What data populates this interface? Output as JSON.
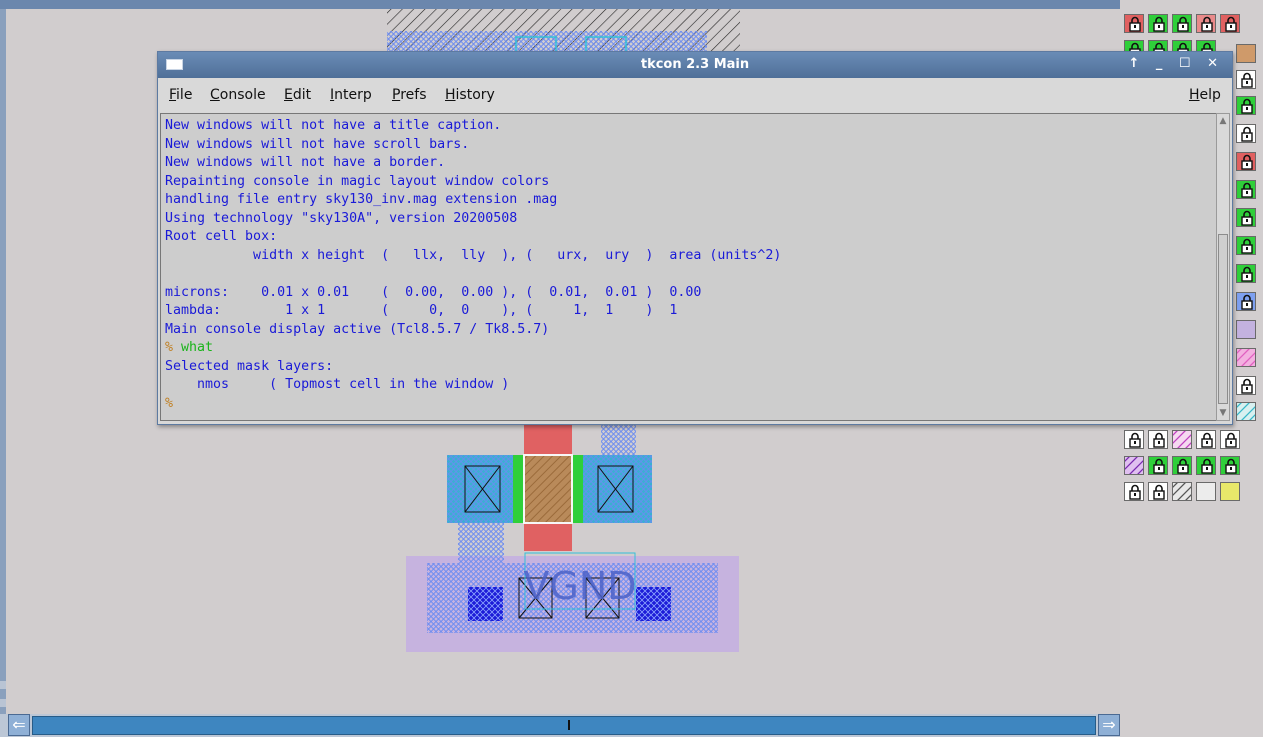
{
  "tkcon": {
    "title": "tkcon 2.3 Main",
    "window_buttons": "↑ _ ☐ ✕",
    "menu": {
      "file": {
        "accel": "F",
        "rest": "ile"
      },
      "console": {
        "accel": "C",
        "rest": "onsole"
      },
      "edit": {
        "accel": "E",
        "rest": "dit"
      },
      "interp": {
        "accel": "I",
        "rest": "nterp"
      },
      "prefs": {
        "accel": "P",
        "rest": "refs"
      },
      "history": {
        "accel": "H",
        "rest": "istory"
      },
      "help": {
        "accel": "H",
        "rest": "elp"
      }
    },
    "console_lines": [
      "New windows will not have a title caption.",
      "New windows will not have scroll bars.",
      "New windows will not have a border.",
      "Repainting console in magic layout window colors",
      "handling file entry sky130_inv.mag extension .mag",
      "Using technology \"sky130A\", version 20200508",
      "Root cell box:",
      "           width x height  (   llx,  lly  ), (   urx,  ury  )  area (units^2)",
      "",
      "microns:    0.01 x 0.01    (  0.00,  0.00 ), (  0.01,  0.01 )  0.00",
      "lambda:        1 x 1       (     0,  0    ), (     1,  1    )  1",
      "Main console display active (Tcl8.5.7 / Tk8.5.7)"
    ],
    "prompt_symbol": "%",
    "command": " what",
    "output_lines": [
      "Selected mask layers:",
      "    nmos     ( Topmost cell in the window )"
    ],
    "last_prompt": "%"
  },
  "layout": {
    "label": "VGND",
    "colors": {
      "poly": "#e06060",
      "diff": "#3aa8c8",
      "implant": "#2fcf3a",
      "metal": "#c3b2df",
      "local_int": "#0000e0",
      "hatch": "#7ea0f0"
    }
  },
  "scrollbar": {
    "left_arrow": "⇐",
    "right_arrow": "⇒"
  }
}
